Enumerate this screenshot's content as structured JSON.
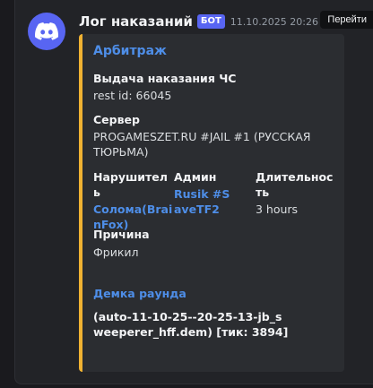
{
  "message": {
    "username": "Лог наказаний",
    "bot_tag": "БОТ",
    "timestamp": "11.10.2025 20:26",
    "goto_label": "Перейти",
    "accent_color": "#f0b232",
    "avatar_icon": "discord-icon"
  },
  "embed": {
    "title": "Арбитраж",
    "punishment": {
      "name": "Выдача наказания ЧС",
      "value": "rest id: 66045"
    },
    "server": {
      "name": "Сервер",
      "value": "PROGAMESZET.RU #JAIL #1 (РУССКАЯ ТЮРЬМА)"
    },
    "violator": {
      "name": "Нарушитель",
      "value": "Солома(BrainFox)"
    },
    "admin": {
      "name": "Админ",
      "value": "Rusik #SaveTF2"
    },
    "duration": {
      "name": "Длительность",
      "value": "3 hours"
    },
    "reason": {
      "name": "Причина",
      "value": "Фрикил"
    },
    "demo": {
      "title": "Демка раунда",
      "value": "(auto-11-10-25--20-25-13-jb_sweeperer_hff.dem) [тик: 3894]"
    }
  }
}
